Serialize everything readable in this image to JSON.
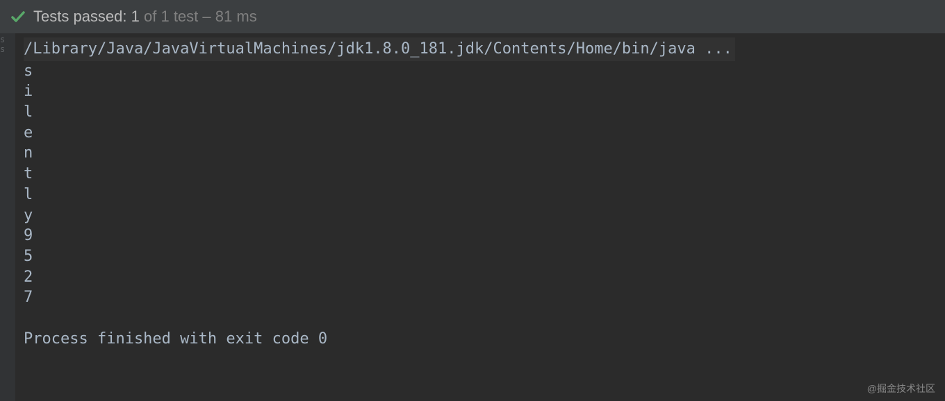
{
  "statusBar": {
    "label": "Tests passed:",
    "count": "1",
    "totalText": "of 1 test",
    "separator": "–",
    "duration": "81 ms"
  },
  "console": {
    "commandLine": "/Library/Java/JavaVirtualMachines/jdk1.8.0_181.jdk/Contents/Home/bin/java ...",
    "outputLines": [
      "s",
      "i",
      "l",
      "e",
      "n",
      "t",
      "l",
      "y",
      "9",
      "5",
      "2",
      "7",
      "",
      "Process finished with exit code 0"
    ]
  },
  "watermark": "@掘金技术社区"
}
